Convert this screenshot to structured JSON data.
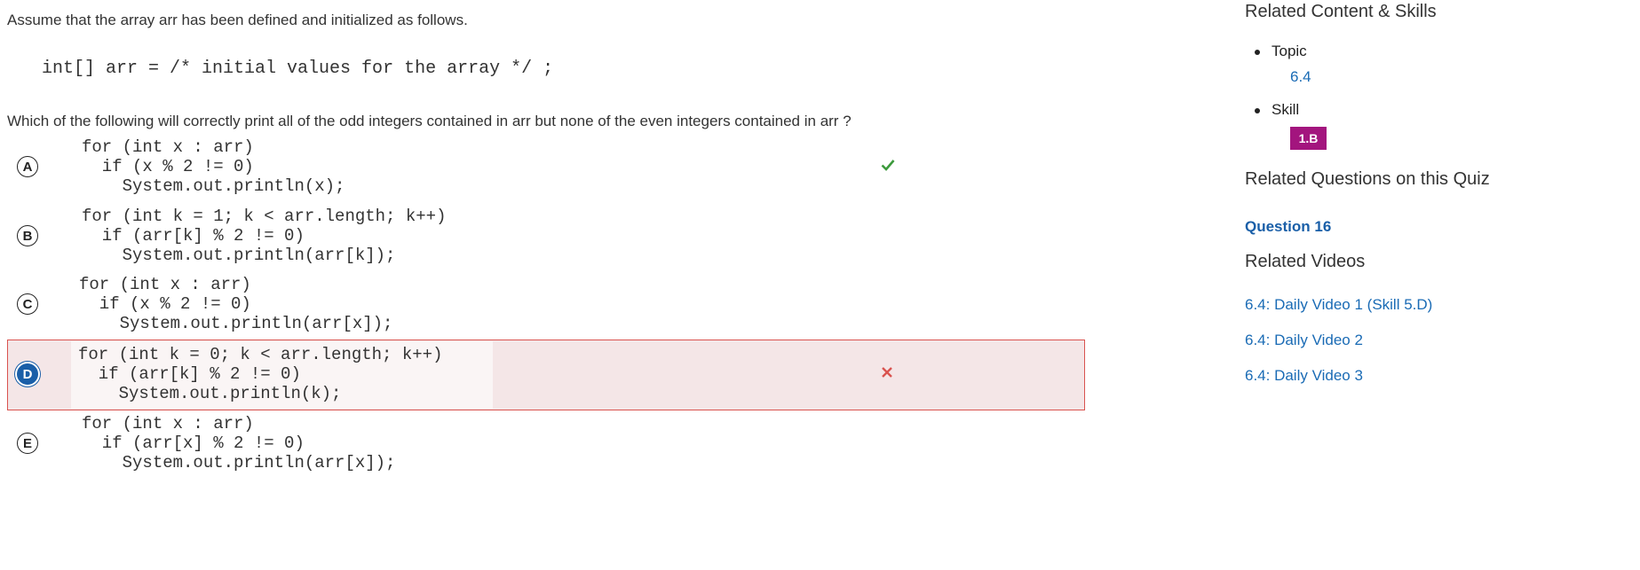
{
  "question": {
    "intro": "Assume that the array arr has been defined and initialized as follows.",
    "declaration": "int[] arr = /* initial values for the array */ ;",
    "prompt": "Which of the following will correctly print all of the odd integers contained in arr but none of the even integers contained in arr ?"
  },
  "choices": [
    {
      "letter": "A",
      "code": "for (int x : arr)\n  if (x % 2 != 0)\n    System.out.println(x);",
      "status": "correct"
    },
    {
      "letter": "B",
      "code": "for (int k = 1; k < arr.length; k++)\n  if (arr[k] % 2 != 0)\n    System.out.println(arr[k]);",
      "status": "none"
    },
    {
      "letter": "C",
      "code": "for (int x : arr)\n  if (x % 2 != 0)\n    System.out.println(arr[x]);",
      "status": "none"
    },
    {
      "letter": "D",
      "code": "for (int k = 0; k < arr.length; k++)\n  if (arr[k] % 2 != 0)\n    System.out.println(k);",
      "status": "selected-incorrect"
    },
    {
      "letter": "E",
      "code": "for (int x : arr)\n  if (arr[x] % 2 != 0)\n    System.out.println(arr[x]);",
      "status": "none"
    }
  ],
  "sidebar": {
    "related_heading": "Related Content & Skills",
    "topic_label": "Topic",
    "topic_value": "6.4",
    "skill_label": "Skill",
    "skill_value": "1.B",
    "related_questions_heading": "Related Questions on this Quiz",
    "related_question_link": "Question 16",
    "related_videos_heading": "Related Videos",
    "videos": [
      "6.4: Daily Video 1 (Skill 5.D)",
      "6.4: Daily Video 2",
      "6.4: Daily Video 3"
    ]
  },
  "colors": {
    "correct": "#3c9a3c",
    "incorrect": "#d9534f",
    "skill_badge": "#a3157e",
    "link": "#1a6bb5",
    "selected_fill": "#1a5fa8"
  },
  "icons": {
    "correct": "check-icon",
    "incorrect": "x-icon"
  }
}
